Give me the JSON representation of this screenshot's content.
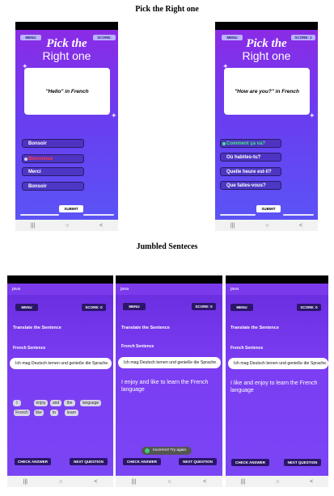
{
  "section1_title": "Pick the Right one",
  "section2_title": "Jumbled Senteces",
  "pick_screens": [
    {
      "menu_label": "MENU",
      "score_label": "SCORE:",
      "title_line1": "Pick the",
      "title_line2": "Right one",
      "question": "\"Hello\" in French",
      "options": [
        {
          "label": "Bonsoir",
          "state": "normal"
        },
        {
          "label": "Bienvenue",
          "state": "wrong"
        },
        {
          "label": "Merci",
          "state": "normal"
        },
        {
          "label": "Bonsoir",
          "state": "normal"
        }
      ],
      "submit_label": "SUBMIT"
    },
    {
      "menu_label": "MENU",
      "score_label": "SCORE: 1",
      "title_line1": "Pick the",
      "title_line2": "Right one",
      "question": "\"How are you?\" in French",
      "options": [
        {
          "label": "Comment ça va?",
          "state": "correct"
        },
        {
          "label": "Où habites-tu?",
          "state": "normal"
        },
        {
          "label": "Quelle heure est-il?",
          "state": "normal"
        },
        {
          "label": "Que faites-vous?",
          "state": "normal"
        }
      ],
      "submit_label": "SUBMIT"
    }
  ],
  "jumbled_screens": [
    {
      "app_name": "java",
      "menu_label": "MENU",
      "score_label": "SCORE: 0",
      "heading": "Translate the Sentence",
      "subheading": "French Sentence",
      "sentence": "Ich mag Deutsch lernen und genieße die Sprache.",
      "chips_row1": [
        "I",
        "enjoy",
        "and",
        "the",
        "language"
      ],
      "chips_row2": [
        "French",
        "like",
        "to",
        "learn"
      ],
      "check_label": "CHECK ANSWER",
      "next_label": "NEXT QUESTION"
    },
    {
      "app_name": "java",
      "menu_label": "MENU",
      "score_label": "SCORE: 0",
      "heading": "Translate the Sentence",
      "subheading": "French Sentence",
      "sentence": "Ich mag Deutsch lernen und genieße die Sprache.",
      "answer": "I enjoy and like to learn the French language",
      "toast": "Incorrect! Try again.",
      "check_label": "CHECK ANSWER",
      "next_label": "NEXT QUESTION"
    },
    {
      "app_name": "java",
      "menu_label": "MENU",
      "score_label": "SCORE: 0",
      "heading": "Translate the Sentence",
      "subheading": "French Sentence",
      "sentence": "Ich mag Deutsch lernen und genieße die Sprache.",
      "answer": "I like and enjoy to learn the French language",
      "check_label": "CHECK ANSWER",
      "next_label": "NEXT QUESTION"
    }
  ],
  "nav_icons": [
    "recent-apps-icon",
    "home-icon",
    "back-icon"
  ],
  "nav_glyphs": {
    "recent": "|||",
    "home": "○",
    "back": "<"
  },
  "colors": {
    "correct": "#3df07a",
    "wrong": "#ff3b3b",
    "accent": "#7c3aed"
  }
}
